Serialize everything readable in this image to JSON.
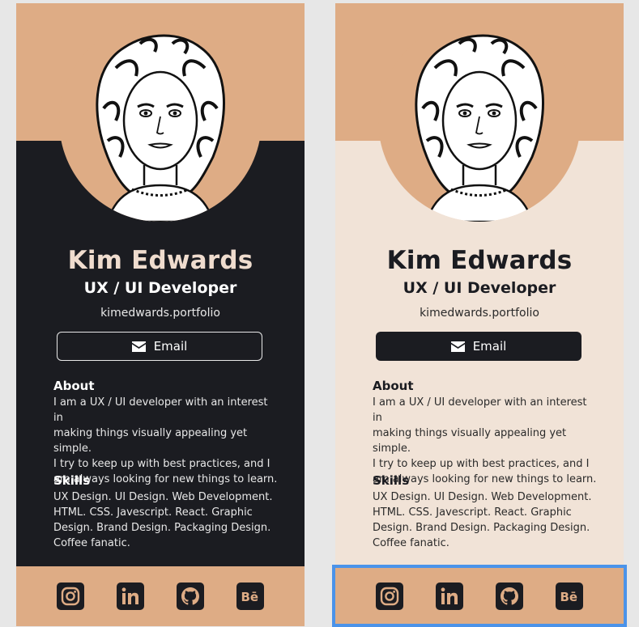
{
  "colors": {
    "accent": "#deac85",
    "dark_bg": "#1b1c21",
    "light_bg": "#f1e3d7",
    "selection": "#4b93e9"
  },
  "profile": {
    "name": "Kim Edwards",
    "role": "UX / UI Developer",
    "website": "kimedwards.portfolio",
    "email_label": "Email",
    "about_title": "About",
    "about_lines": [
      "I am a UX / UI developer with an interest in",
      "making things visually appealing yet simple.",
      "I try to keep up with best practices, and I",
      "am always looking for new things to learn."
    ],
    "skills_title": "Skills",
    "skills_lines": [
      "UX Design. UI Design. Web Development.",
      "HTML. CSS. Javescript. React. Graphic",
      "Design. Brand Design. Packaging Design.",
      "Coffee fanatic."
    ]
  },
  "social_icons": [
    "instagram-icon",
    "linkedin-icon",
    "github-icon",
    "behance-icon"
  ]
}
